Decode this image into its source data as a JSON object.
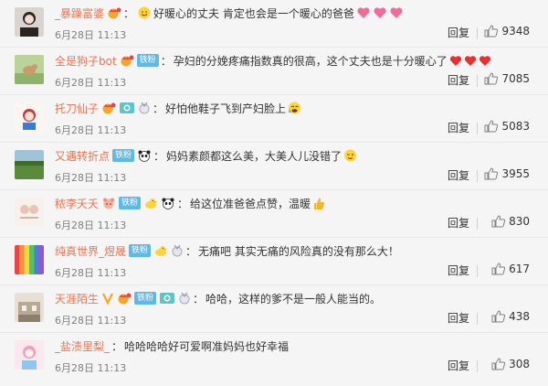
{
  "comments": [
    {
      "user": "_暴躁富婆",
      "fan": "",
      "text": "好暖心的丈夫 肯定也会是一个暖心的爸爸",
      "date": "6月28日 11:13",
      "reply": "回复",
      "likes": "9348"
    },
    {
      "user": "全是狗子bot",
      "fan": "铁粉",
      "text": "孕妇的分娩疼痛指数真的很高，这个丈夫也是十分暖心了",
      "date": "6月28日 11:13",
      "reply": "回复",
      "likes": "7085"
    },
    {
      "user": "托刀仙子",
      "fan": "",
      "text": "好怕他鞋子飞到产妇脸上",
      "date": "6月28日 11:13",
      "reply": "回复",
      "likes": "5083"
    },
    {
      "user": "又遇转折点",
      "fan": "铁粉",
      "text": "妈妈素颜都这么美，大美人儿没错了",
      "date": "6月28日 11:13",
      "reply": "回复",
      "likes": "3955"
    },
    {
      "user": "秾李夭夭",
      "fan": "铁粉",
      "text": "给这位准爸爸点赞，温暖",
      "date": "6月28日 11:13",
      "reply": "回复",
      "likes": "830"
    },
    {
      "user": "纯真世界_煜晟",
      "fan": "铁粉",
      "text": "无痛吧 其实无痛的风险真的没有那么大！",
      "date": "6月28日 11:13",
      "reply": "回复",
      "likes": "617"
    },
    {
      "user": "天涯陌生",
      "fan": "铁粉",
      "text": "哈哈，这样的爹不是一般人能当的。",
      "date": "6月28日 11:13",
      "reply": "回复",
      "likes": "438"
    },
    {
      "user": "_盐渍里梨_",
      "fan": "",
      "text": "哈哈哈哈好可爱啊准妈妈也好幸福",
      "date": "6月28日 11:13",
      "reply": "回复",
      "likes": "308"
    }
  ]
}
